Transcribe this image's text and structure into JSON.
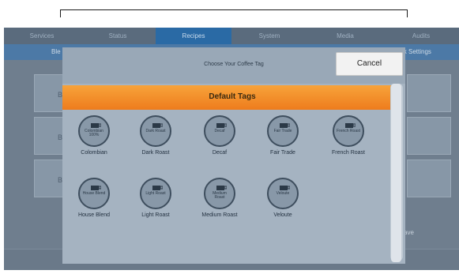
{
  "topnav": {
    "tabs": [
      {
        "label": "Services",
        "active": false
      },
      {
        "label": "Status",
        "active": false
      },
      {
        "label": "Recipes",
        "active": true
      },
      {
        "label": "System",
        "active": false
      },
      {
        "label": "Media",
        "active": false
      },
      {
        "label": "Audits",
        "active": false
      }
    ]
  },
  "subnav": {
    "left_label": "Ble",
    "right_label": "ick Settings"
  },
  "background": {
    "row_letters": [
      "B",
      "B",
      "B"
    ],
    "save_label": "ave"
  },
  "modal": {
    "title": "Choose Your Coffee Tag",
    "cancel_label": "Cancel",
    "section_title": "Default Tags",
    "tags": [
      {
        "label": "Colombian",
        "badge_text": "Colombian 100%",
        "icon": "coffee-cup-icon"
      },
      {
        "label": "Dark Roast",
        "badge_text": "Dark Roast",
        "icon": "coffee-cup-icon"
      },
      {
        "label": "Decaf",
        "badge_text": "Decaf",
        "icon": "coffee-cup-icon"
      },
      {
        "label": "Fair Trade",
        "badge_text": "Fair Trade",
        "icon": "coffee-cup-icon"
      },
      {
        "label": "French Roast",
        "badge_text": "French Roast",
        "icon": "coffee-cup-icon"
      },
      {
        "label": "House Blend",
        "badge_text": "House Blend",
        "icon": "coffee-cup-icon"
      },
      {
        "label": "Light Roast",
        "badge_text": "Light Roast",
        "icon": "coffee-cup-icon"
      },
      {
        "label": "Medium Roast",
        "badge_text": "Medium Roast",
        "icon": "coffee-cup-icon"
      },
      {
        "label": "Veloute",
        "badge_text": "Veloute",
        "icon": "coffee-cup-icon"
      }
    ]
  },
  "colors": {
    "active_tab": "#2a6aa5",
    "section_header": "#f28a26",
    "modal_bg": "#a5b3c1"
  }
}
